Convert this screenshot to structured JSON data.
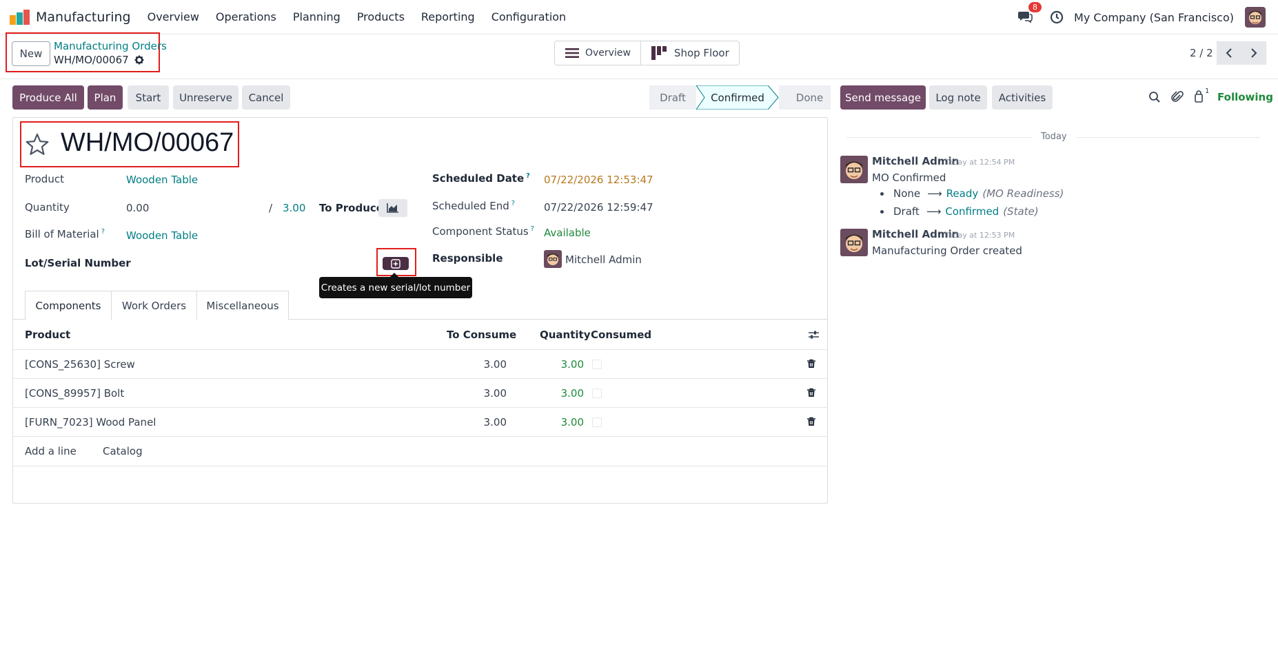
{
  "app": {
    "name": "Manufacturing"
  },
  "menu": [
    "Overview",
    "Operations",
    "Planning",
    "Products",
    "Reporting",
    "Configuration"
  ],
  "navbar": {
    "message_count": "8",
    "company": "My Company (San Francisco)"
  },
  "control": {
    "new_label": "New",
    "breadcrumb_parent": "Manufacturing Orders",
    "breadcrumb_current": "WH/MO/00067",
    "views": {
      "overview": "Overview",
      "shop_floor": "Shop Floor"
    },
    "pager": "2 / 2"
  },
  "actions": {
    "produce_all": "Produce All",
    "plan": "Plan",
    "start": "Start",
    "unreserve": "Unreserve",
    "cancel": "Cancel"
  },
  "status": {
    "stages": [
      "Draft",
      "Confirmed",
      "Done"
    ],
    "current": "Confirmed"
  },
  "form": {
    "title": "WH/MO/00067",
    "product_label": "Product",
    "product_value": "Wooden Table",
    "quantity_label": "Quantity",
    "quantity_value": "0.00",
    "quantity_sep": "/",
    "quantity_total": "3.00",
    "to_produce_label": "To Produce",
    "bom_label": "Bill of Material",
    "bom_value": "Wooden Table",
    "lot_label": "Lot/Serial Number",
    "scheduled_date_label": "Scheduled Date",
    "scheduled_date_value": "07/22/2026 12:53:47",
    "scheduled_end_label": "Scheduled End",
    "scheduled_end_value": "07/22/2026 12:59:47",
    "component_status_label": "Component Status",
    "component_status_value": "Available",
    "responsible_label": "Responsible",
    "responsible_value": "Mitchell Admin",
    "help_mark": "?",
    "tooltip": "Creates a new serial/lot number"
  },
  "tabs": [
    "Components",
    "Work Orders",
    "Miscellaneous"
  ],
  "table": {
    "headers": {
      "product": "Product",
      "to_consume": "To Consume",
      "quantity": "Quantity",
      "consumed": "Consumed"
    },
    "rows": [
      {
        "product": "[CONS_25630] Screw",
        "to_consume": "3.00",
        "quantity": "3.00"
      },
      {
        "product": "[CONS_89957] Bolt",
        "to_consume": "3.00",
        "quantity": "3.00"
      },
      {
        "product": "[FURN_7023] Wood Panel",
        "to_consume": "3.00",
        "quantity": "3.00"
      }
    ],
    "add_line": "Add a line",
    "catalog": "Catalog"
  },
  "chatter": {
    "send_message": "Send message",
    "log_note": "Log note",
    "activities": "Activities",
    "followers_count": "1",
    "following": "Following",
    "date_separator": "Today",
    "messages": [
      {
        "author": "Mitchell Admin",
        "time": "Today at 12:54 PM",
        "body": "MO Confirmed",
        "tracking": [
          {
            "old": "None",
            "new": "Ready",
            "field": "(MO Readiness)"
          },
          {
            "old": "Draft",
            "new": "Confirmed",
            "field": "(State)"
          }
        ]
      },
      {
        "author": "Mitchell Admin",
        "time": "Today at 12:53 PM",
        "body": "Manufacturing Order created"
      }
    ]
  },
  "colors": {
    "brand": "#714b67",
    "link": "#017e84",
    "success": "#1e8a3a",
    "warning": "#b7791f",
    "annotation": "#e11d1d"
  },
  "icons": [
    "app-logo-icon",
    "chat-icon",
    "clock-icon",
    "gear-icon",
    "list-icon",
    "kanban-icon",
    "chevron-left-icon",
    "chevron-right-icon",
    "star-icon",
    "chart-icon",
    "plus-square-icon",
    "settings-sliders-icon",
    "trash-icon",
    "search-icon",
    "paperclip-icon",
    "user-icon"
  ]
}
